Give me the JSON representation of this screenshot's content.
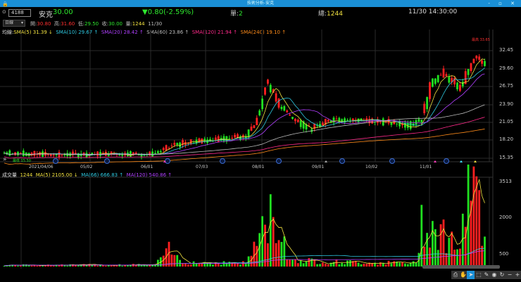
{
  "window": {
    "title": "技術分析-安克",
    "controls": "- ▫ ✕"
  },
  "header": {
    "code": "4188",
    "name": "安克",
    "price": "30.00",
    "change": "▼0.80(-2.59%)",
    "single_label": "單:",
    "single": "2",
    "total_label": "總:",
    "total": "1244",
    "datetime": "11/30 14:30:00"
  },
  "ohlc_row": {
    "period": "日線",
    "open_label": "開:",
    "open": "30.80",
    "high_label": "高:",
    "high": "31.60",
    "low_label": "低:",
    "low": "29.50",
    "close_label": "收:",
    "close": "30.00",
    "vol_label": "量:",
    "vol": "1244",
    "date": "11/30"
  },
  "ma_legend": {
    "label": "均線:",
    "items": [
      {
        "text": "SMA(5) 31.39 ↓",
        "color": "#f0e040"
      },
      {
        "text": "SMA(10) 29.67 ↑",
        "color": "#2ec8e0"
      },
      {
        "text": "SMA(20) 28.42 ↑",
        "color": "#b040ff"
      },
      {
        "text": "SMA(60) 23.86 ↑",
        "color": "#bbbbbb"
      },
      {
        "text": "SMA(120) 21.94 ↑",
        "color": "#ff2a8a"
      },
      {
        "text": "SMA(240) 19.10 ↑",
        "color": "#ff8c1a"
      }
    ]
  },
  "vol_legend": {
    "label": "成交量",
    "value": "1244",
    "items": [
      {
        "text": "MA(5) 2105.00 ↓",
        "color": "#f0e040"
      },
      {
        "text": "MA(66) 666.83 ↑",
        "color": "#2ec8e0"
      },
      {
        "text": "MA(120) 540.86 ↑",
        "color": "#b040ff"
      }
    ]
  },
  "price_axis": [
    "32.45",
    "29.60",
    "26.75",
    "23.90",
    "21.05",
    "18.20",
    "15.35"
  ],
  "volume_axis": [
    "3513",
    "2000",
    "500"
  ],
  "date_axis": [
    "2021/04/06",
    "05/02",
    "06/01",
    "07/03",
    "08/01",
    "09/01",
    "10/02",
    "11/01"
  ],
  "annotations": {
    "high": "最高 33.65",
    "low": "最低 15.50"
  },
  "chart_data": {
    "type": "candlestick",
    "ylim": [
      15.35,
      33.65
    ],
    "price_path": [
      [
        0,
        16.2
      ],
      [
        20,
        15.9
      ],
      [
        40,
        16.1
      ],
      [
        55,
        16.0
      ],
      [
        62,
        17.5
      ],
      [
        75,
        18.3
      ],
      [
        88,
        18.8
      ],
      [
        92,
        21
      ],
      [
        96,
        27.5
      ],
      [
        100,
        24
      ],
      [
        106,
        21.5
      ],
      [
        112,
        20
      ],
      [
        120,
        21.6
      ],
      [
        135,
        21.3
      ],
      [
        148,
        20.6
      ],
      [
        152,
        21.5
      ],
      [
        156,
        27.5
      ],
      [
        160,
        28.8
      ],
      [
        166,
        26.5
      ],
      [
        172,
        31.5
      ],
      [
        175,
        30.0
      ]
    ],
    "volume_path": [
      [
        0,
        60
      ],
      [
        55,
        80
      ],
      [
        60,
        700
      ],
      [
        65,
        200
      ],
      [
        88,
        150
      ],
      [
        94,
        1600
      ],
      [
        98,
        2300
      ],
      [
        104,
        300
      ],
      [
        120,
        200
      ],
      [
        150,
        150
      ],
      [
        152,
        2100
      ],
      [
        158,
        1600
      ],
      [
        166,
        900
      ],
      [
        170,
        3513
      ],
      [
        173,
        2600
      ],
      [
        175,
        1244
      ]
    ],
    "volume_ylim": [
      0,
      3513
    ]
  },
  "colors": {
    "up": "#ff2020",
    "down": "#20e020",
    "titlebar": "#1a8fd6"
  },
  "toolbar": [
    "print-icon",
    "hand-icon",
    "cursor-icon",
    "zoom-box-icon",
    "draw-icon",
    "eye-icon",
    "refresh-icon",
    "minus-icon",
    "plus-icon"
  ]
}
